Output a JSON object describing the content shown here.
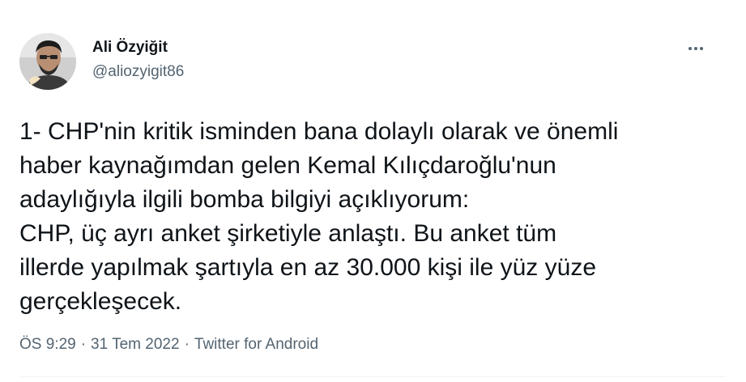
{
  "tweet": {
    "author": {
      "name": "Ali Özyiğit",
      "handle": "@aliozyigit86"
    },
    "more_icon": "more-horizontal-icon",
    "text_lines": [
      "1- CHP'nin kritik isminden bana dolaylı olarak ve önemli",
      "haber kaynağımdan gelen Kemal Kılıçdaroğlu'nun",
      "adaylığıyla ilgili bomba bilgiyi açıklıyorum:",
      "CHP, üç ayrı anket şirketiyle anlaştı. Bu anket tüm",
      "illerde yapılmak şartıyla en az 30.000 kişi ile yüz yüze",
      "gerçekleşecek."
    ],
    "time": "ÖS 9:29",
    "date": "31 Tem 2022",
    "source": "Twitter for Android",
    "separator": "·"
  },
  "colors": {
    "text": "#0f1419",
    "secondary": "#536471",
    "divider": "#eff3f4"
  }
}
